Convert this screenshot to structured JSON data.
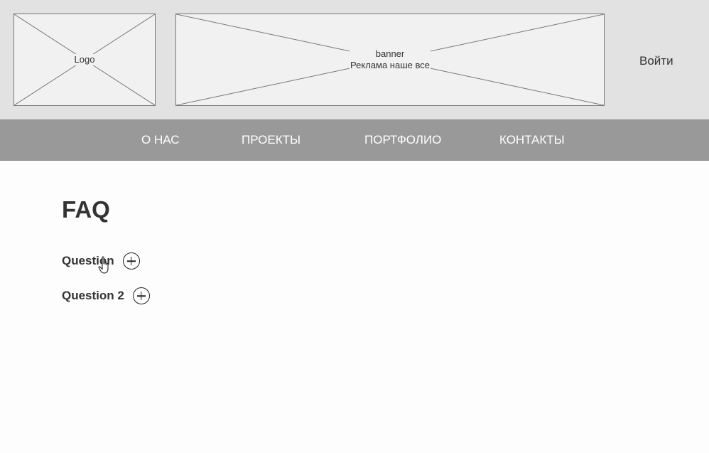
{
  "header": {
    "logo_text": "Logo",
    "banner_line1": "banner",
    "banner_line2": "Реклама наше все",
    "login_label": "Войти"
  },
  "nav": {
    "items": [
      {
        "label": "О НАС"
      },
      {
        "label": "ПРОЕКТЫ"
      },
      {
        "label": "ПОРТФОЛИО"
      },
      {
        "label": "КОНТАКТЫ"
      }
    ]
  },
  "faq": {
    "title": "FAQ",
    "questions": [
      {
        "label": "Question"
      },
      {
        "label": "Question 2"
      }
    ]
  },
  "icons": {
    "expand": "plus-circle-icon",
    "cursor": "hand-pointer-icon"
  },
  "colors": {
    "header_bg": "#e2e2e2",
    "nav_bg": "#999999",
    "nav_text": "#ffffff",
    "text": "#333333"
  }
}
